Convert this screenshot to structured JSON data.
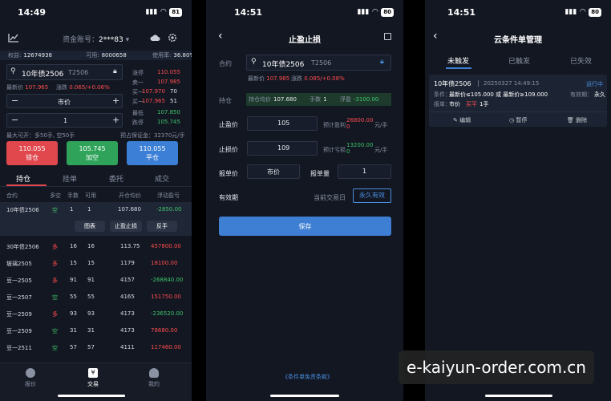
{
  "watermark": "e-kaiyun-order.com.cn",
  "p1": {
    "time": "14:49",
    "battery": "81",
    "account_label": "资金账号：",
    "account_value": "2***83",
    "equity_label": "权益:",
    "equity_value": "12674938",
    "available_label": "可用:",
    "available_value": "8000658",
    "usage_label": "使用率:",
    "usage_value": "36.80%",
    "contract_name": "10年债2506",
    "contract_code": "T2506",
    "last_label": "最新价",
    "last_value": "107.965",
    "change_label": "涨跌",
    "change_value": "0.065/+0.06%",
    "price_type": "市价",
    "minus": "−",
    "plus": "+",
    "quantity": "1",
    "book": [
      {
        "label": "涨停",
        "value": "110.055"
      },
      {
        "label": "卖一",
        "value": "107.985"
      },
      {
        "label": "买一",
        "value": "107.970",
        "vol": "70"
      },
      {
        "label": "买一",
        "value": "107.965",
        "vol": "51"
      },
      {
        "label": "最低",
        "value": "107.850"
      },
      {
        "label": "跌停",
        "value": "105.745"
      }
    ],
    "max_open": "最大可开：多50手, 空50手",
    "margin": "预占保证金：32370元/手",
    "btn_lock_price": "110.055",
    "btn_lock_label": "锁仓",
    "btn_short_price": "105.745",
    "btn_short_label": "加空",
    "btn_close_price": "110.055",
    "btn_close_label": "平仓",
    "tabs": [
      "持仓",
      "挂单",
      "委托",
      "成交"
    ],
    "columns": [
      "合约",
      "多空",
      "手数",
      "可用",
      "开仓均价",
      "浮动盈亏"
    ],
    "selected_row": {
      "name": "10年债2506",
      "dir": "空",
      "lots": "1",
      "avail": "1",
      "avg": "107.680",
      "pnl": "-2850.00"
    },
    "row_actions": [
      "图表",
      "止盈止损",
      "反手"
    ],
    "rows": [
      {
        "name": "30年债2506",
        "dir": "多",
        "lots": "16",
        "avail": "16",
        "avg": "113.75",
        "pnl": "457800.00"
      },
      {
        "name": "玻璃2505",
        "dir": "多",
        "lots": "15",
        "avail": "15",
        "avg": "1179",
        "pnl": "18100.00"
      },
      {
        "name": "豆一2505",
        "dir": "多",
        "lots": "91",
        "avail": "91",
        "avg": "4157",
        "pnl": "-268840.00"
      },
      {
        "name": "豆一2507",
        "dir": "空",
        "lots": "55",
        "avail": "55",
        "avg": "4165",
        "pnl": "151750.00"
      },
      {
        "name": "豆一2509",
        "dir": "多",
        "lots": "93",
        "avail": "93",
        "avg": "4173",
        "pnl": "-236520.00"
      },
      {
        "name": "豆一2509",
        "dir": "空",
        "lots": "31",
        "avail": "31",
        "avg": "4173",
        "pnl": "78680.00"
      },
      {
        "name": "豆一2511",
        "dir": "空",
        "lots": "57",
        "avail": "57",
        "avg": "4111",
        "pnl": "117460.00"
      }
    ],
    "nav": [
      "报价",
      "交易",
      "我的"
    ]
  },
  "p2": {
    "time": "14:51",
    "battery": "80",
    "title": "止盈止损",
    "contract_label": "合约",
    "contract_name": "10年债2506",
    "contract_code": "T2506",
    "last_label": "最新价",
    "last_value": "107.985",
    "change_label": "涨跌",
    "change_value": "0.085/+0.08%",
    "position_label": "持仓",
    "avg_label": "持仓均价",
    "avg_value": "107.680",
    "lots_label": "手数",
    "lots_value": "1",
    "float_label": "浮盈",
    "float_value": "-3100.00",
    "tp_label": "止盈价",
    "tp_value": "105",
    "tp_est_label": "预计盈利",
    "tp_est_value": "26800.00",
    "tp_est_zero": "0",
    "unit": "元/手",
    "sl_label": "止损价",
    "sl_value": "109",
    "sl_est_label": "预计亏损",
    "sl_est_value": "13200.00",
    "sl_est_zero": "0",
    "order_price_label": "报单价",
    "order_price_value": "市价",
    "order_qty_label": "报单量",
    "order_qty_value": "1",
    "validity_label": "有效期",
    "validity_opt1": "当前交易日",
    "validity_opt2": "永久有效",
    "save": "保存",
    "terms": "《条件单免责条款》"
  },
  "p3": {
    "time": "14:51",
    "battery": "80",
    "title": "云条件单管理",
    "tabs": [
      "未触发",
      "已触发",
      "已失效"
    ],
    "card": {
      "name": "10年债2506",
      "sep": "|",
      "datetime": "20250327 14:49:15",
      "status": "运行中",
      "cond_label": "条件：",
      "cond_value": "最新价≤105.000 或 最新价≥109.000",
      "valid_label": "有效期：",
      "valid_value": "永久",
      "order_label": "报单：",
      "order_value": "市价",
      "order_side": "买平",
      "order_qty": "1手",
      "actions": [
        "编辑",
        "暂停",
        "删除"
      ]
    }
  }
}
